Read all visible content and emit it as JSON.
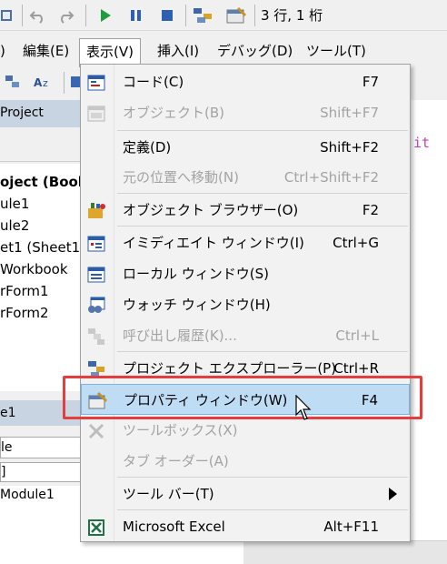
{
  "toolbar": {
    "row_col": "3 行, 1 桁"
  },
  "menubar": {
    "items": [
      {
        "label": ")"
      },
      {
        "label": "編集(E)"
      },
      {
        "label": "表示(V)"
      },
      {
        "label": "挿入(I)"
      },
      {
        "label": "デバッグ(D)"
      },
      {
        "label": "ツール(T)"
      }
    ]
  },
  "project_panel": {
    "title": "Project",
    "tree": [
      {
        "label": "oject (Book"
      },
      {
        "label": "ule1"
      },
      {
        "label": "ule2"
      },
      {
        "label": "et1 (Sheet1"
      },
      {
        "label": "Workbook"
      },
      {
        "label": "rForm1"
      },
      {
        "label": "rForm2"
      }
    ]
  },
  "properties_panel": {
    "title": "e1",
    "combo_value": "le",
    "tab_label": "]",
    "row_value": "Module1"
  },
  "code": {
    "visible_text": "it"
  },
  "view_menu": {
    "items": [
      {
        "label": "コード(C)",
        "shortcut": "F7",
        "icon": "code-icon",
        "enabled": true
      },
      {
        "label": "オブジェクト(B)",
        "shortcut": "Shift+F7",
        "icon": "object-icon",
        "enabled": false
      },
      {
        "label": "定義(D)",
        "shortcut": "Shift+F2",
        "icon": "",
        "enabled": true
      },
      {
        "label": "元の位置へ移動(N)",
        "shortcut": "Ctrl+Shift+F2",
        "icon": "",
        "enabled": false
      },
      {
        "label": "オブジェクト ブラウザー(O)",
        "shortcut": "F2",
        "icon": "object-browser-icon",
        "enabled": true
      },
      {
        "label": "イミディエイト ウィンドウ(I)",
        "shortcut": "Ctrl+G",
        "icon": "immediate-window-icon",
        "enabled": true
      },
      {
        "label": "ローカル ウィンドウ(S)",
        "shortcut": "",
        "icon": "locals-window-icon",
        "enabled": true
      },
      {
        "label": "ウォッチ ウィンドウ(H)",
        "shortcut": "",
        "icon": "watch-window-icon",
        "enabled": true
      },
      {
        "label": "呼び出し履歴(K)...",
        "shortcut": "Ctrl+L",
        "icon": "call-stack-icon",
        "enabled": false
      },
      {
        "label": "プロジェクト エクスプローラー(P)",
        "shortcut": "Ctrl+R",
        "icon": "project-explorer-icon",
        "enabled": true
      },
      {
        "label": "プロパティ ウィンドウ(W)",
        "shortcut": "F4",
        "icon": "properties-window-icon",
        "enabled": true,
        "highlighted": true
      },
      {
        "label": "ツールボックス(X)",
        "shortcut": "",
        "icon": "toolbox-icon",
        "enabled": false
      },
      {
        "label": "タブ オーダー(A)",
        "shortcut": "",
        "icon": "",
        "enabled": false
      },
      {
        "label": "ツール バー(T)",
        "shortcut": "",
        "icon": "",
        "enabled": true,
        "submenu": true
      },
      {
        "label": "Microsoft Excel",
        "shortcut": "Alt+F11",
        "icon": "excel-icon",
        "enabled": true
      }
    ]
  },
  "colors": {
    "highlight": "#bfdcf5",
    "annotation_box": "#e53d3d",
    "panel_title": "#c9d4e3"
  }
}
